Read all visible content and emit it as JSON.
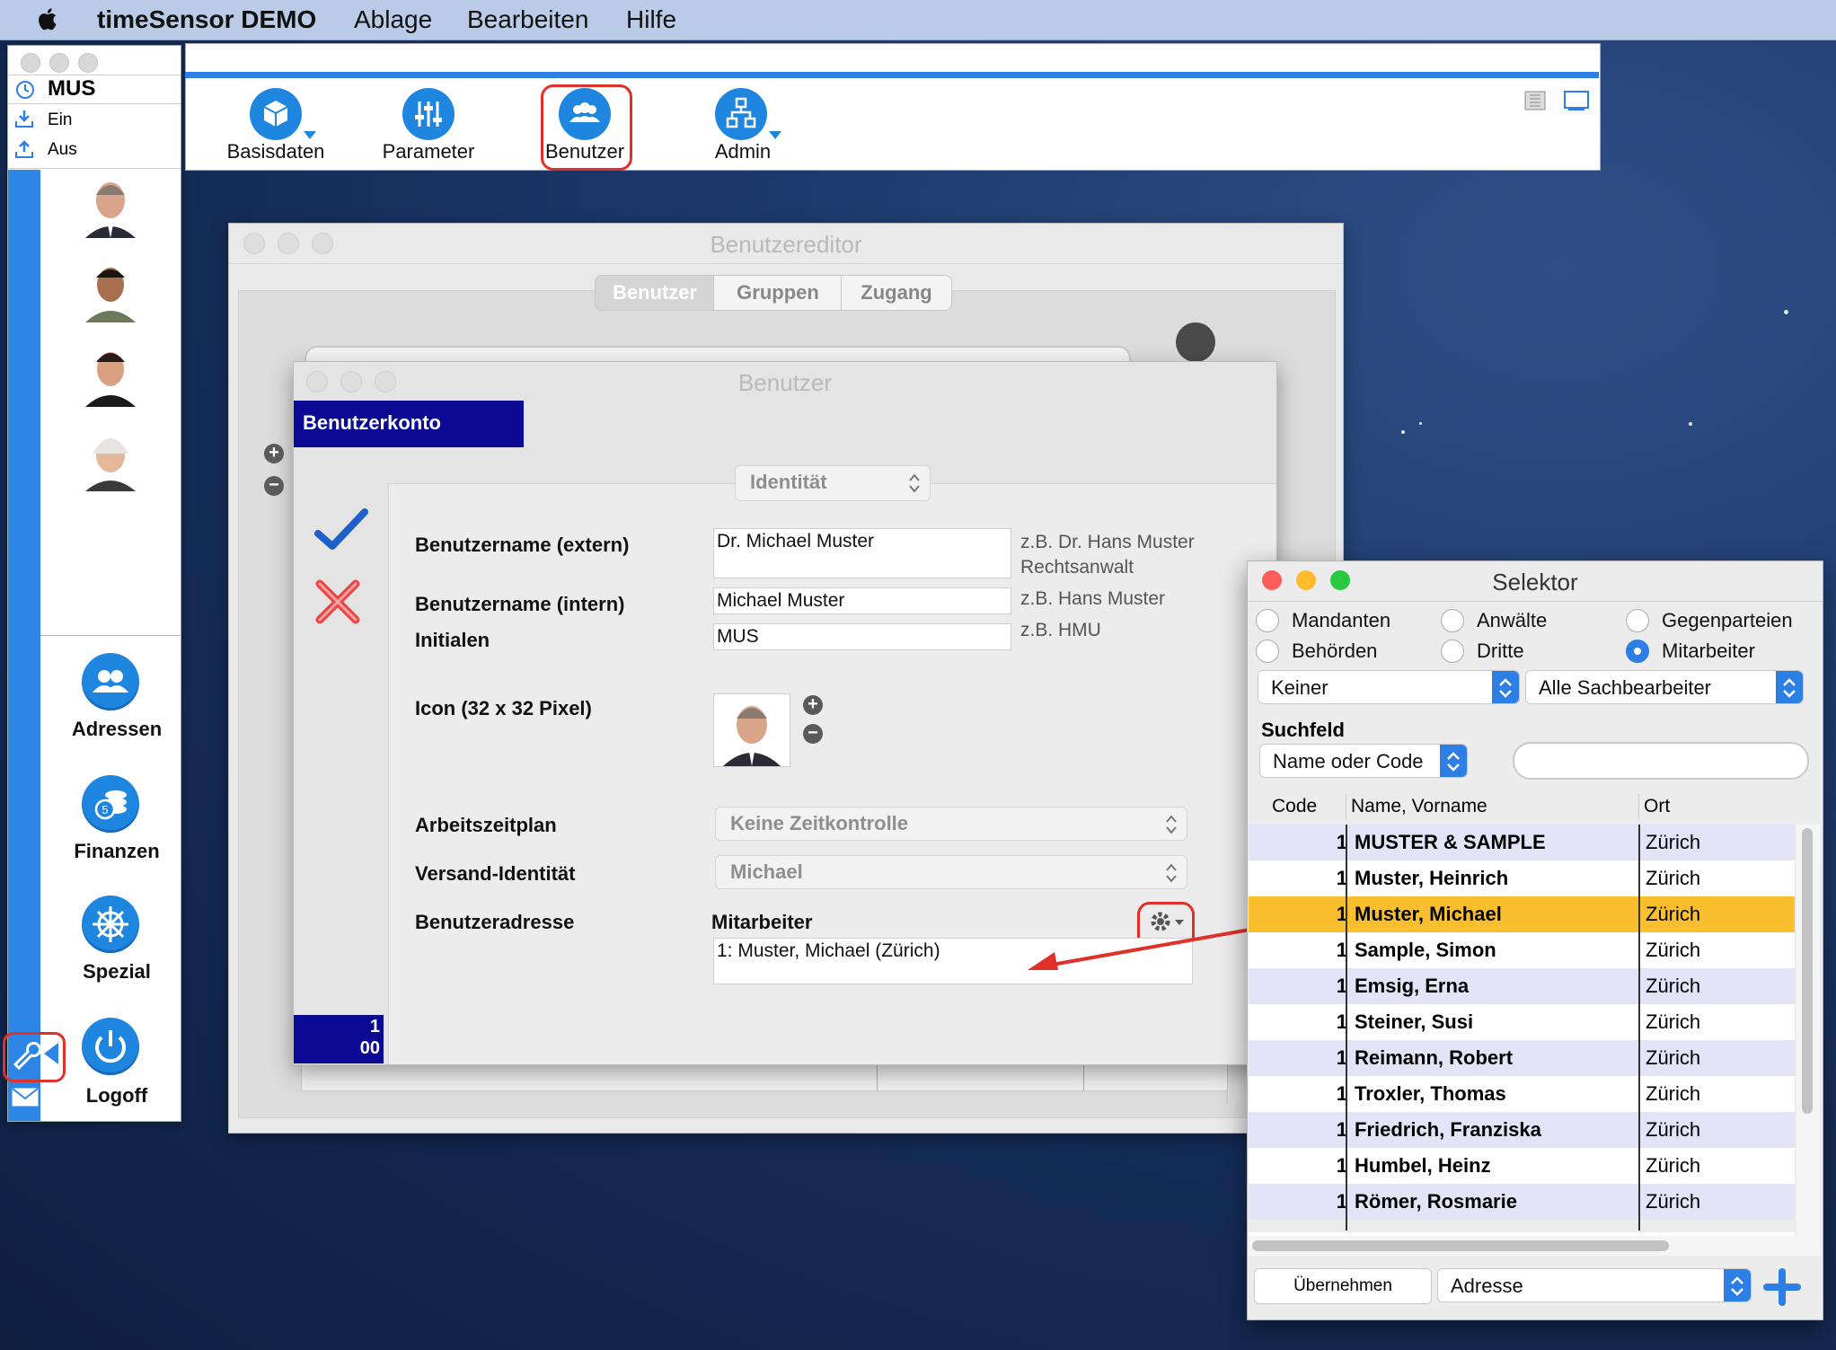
{
  "menubar": {
    "app_name": "timeSensor DEMO",
    "items": [
      "Ablage",
      "Bearbeiten",
      "Hilfe"
    ]
  },
  "sidebar": {
    "user_code": "MUS",
    "ein_label": "Ein",
    "aus_label": "Aus",
    "buttons": [
      {
        "label": "Adressen",
        "icon": "people-icon"
      },
      {
        "label": "Finanzen",
        "icon": "coins-icon"
      },
      {
        "label": "Spezial",
        "icon": "wheel-icon"
      },
      {
        "label": "Logoff",
        "icon": "power-icon"
      }
    ]
  },
  "toolbar": {
    "items": [
      {
        "label": "Basisdaten",
        "icon": "cube-icon"
      },
      {
        "label": "Parameter",
        "icon": "sliders-icon"
      },
      {
        "label": "Benutzer",
        "icon": "people-icon"
      },
      {
        "label": "Admin",
        "icon": "hierarchy-icon"
      }
    ]
  },
  "editor": {
    "title": "Benutzereditor",
    "tabs": [
      "Benutzer",
      "Gruppen",
      "Zugang"
    ],
    "active_tab": "Benutzer"
  },
  "dialog": {
    "title": "Benutzer",
    "header": "Benutzerkonto",
    "section_select": "Identität",
    "counter": [
      "1",
      "00"
    ],
    "fields": {
      "extern_label": "Benutzername (extern)",
      "extern_value": "Dr. Michael Muster",
      "extern_hint": "z.B. Dr. Hans Muster Rechtsanwalt",
      "intern_label": "Benutzername (intern)",
      "intern_value": "Michael Muster",
      "intern_hint": "z.B. Hans Muster",
      "initialen_label": "Initialen",
      "initialen_value": "MUS",
      "initialen_hint": "z.B. HMU",
      "icon_label": "Icon (32 x 32 Pixel)",
      "arbeitszeit_label": "Arbeitszeitplan",
      "arbeitszeit_value": "Keine Zeitkontrolle",
      "versand_label": "Versand-Identität",
      "versand_value": "Michael",
      "adresse_label": "Benutzeradresse",
      "adresse_type": "Mitarbeiter",
      "adresse_value": "1: Muster, Michael (Zürich)"
    }
  },
  "selektor": {
    "title": "Selektor",
    "radios": [
      {
        "label": "Mandanten",
        "selected": false
      },
      {
        "label": "Anwälte",
        "selected": false
      },
      {
        "label": "Gegenparteien",
        "selected": false
      },
      {
        "label": "Behörden",
        "selected": false
      },
      {
        "label": "Dritte",
        "selected": false
      },
      {
        "label": "Mitarbeiter",
        "selected": true
      }
    ],
    "filter1": "Keiner",
    "filter2": "Alle Sachbearbeiter",
    "search_label": "Suchfeld",
    "search_mode": "Name oder Code",
    "search_value": "",
    "columns": [
      "Code",
      "Name, Vorname",
      "Ort"
    ],
    "rows": [
      {
        "code": "1",
        "name": "MUSTER & SAMPLE",
        "ort": "Zürich"
      },
      {
        "code": "1",
        "name": "Muster, Heinrich",
        "ort": "Zürich"
      },
      {
        "code": "1",
        "name": "Muster, Michael",
        "ort": "Zürich",
        "selected": true
      },
      {
        "code": "1",
        "name": "Sample, Simon",
        "ort": "Zürich"
      },
      {
        "code": "1",
        "name": "Emsig, Erna",
        "ort": "Zürich"
      },
      {
        "code": "1",
        "name": "Steiner, Susi",
        "ort": "Zürich"
      },
      {
        "code": "1",
        "name": "Reimann, Robert",
        "ort": "Zürich"
      },
      {
        "code": "1",
        "name": "Troxler, Thomas",
        "ort": "Zürich"
      },
      {
        "code": "1",
        "name": "Friedrich, Franziska",
        "ort": "Zürich"
      },
      {
        "code": "1",
        "name": "Humbel, Heinz",
        "ort": "Zürich"
      },
      {
        "code": "1",
        "name": "Römer, Rosmarie",
        "ort": "Zürich"
      }
    ],
    "apply_button": "Übernehmen",
    "target_select": "Adresse"
  },
  "colors": {
    "accent": "#2d7ee5",
    "selected_row": "#f9bf2f",
    "alt_row": "#e3e4f8",
    "header_blue": "#0a0a94",
    "highlight": "#e0302a"
  }
}
